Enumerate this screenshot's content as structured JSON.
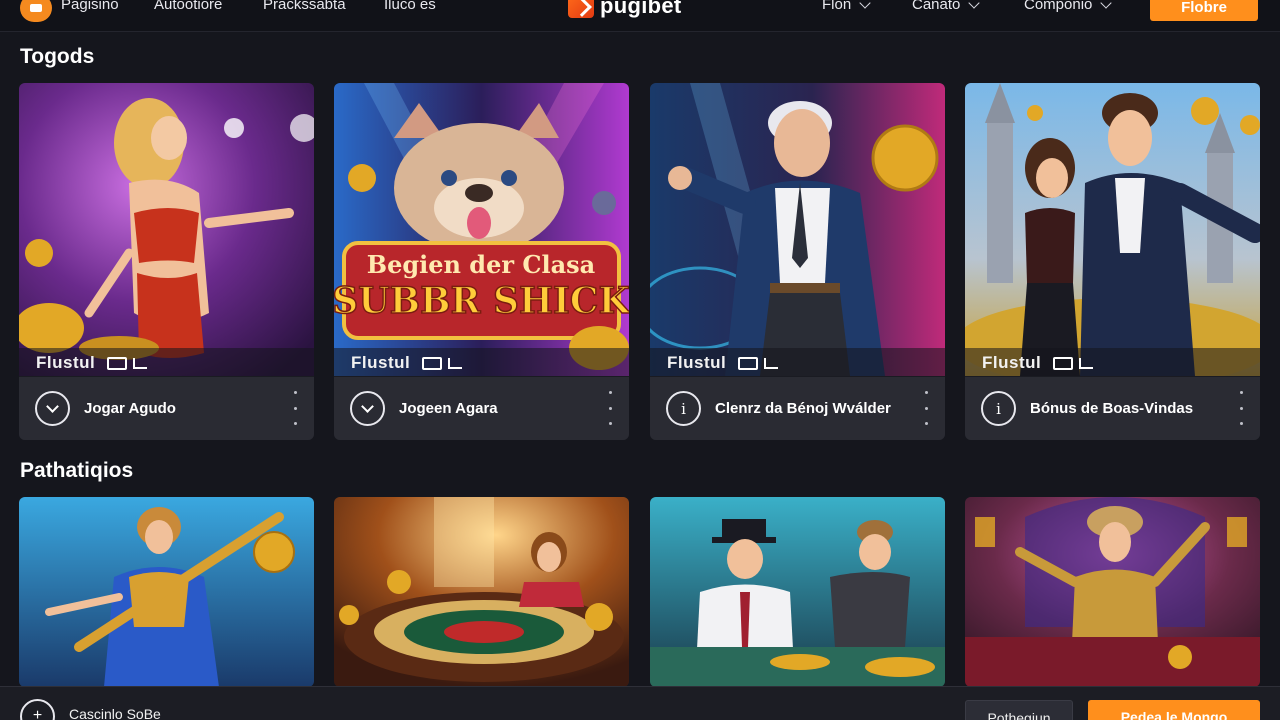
{
  "header": {
    "nav": [
      "Pagisino",
      "Autootiore",
      "Prackssabta",
      "Iluco es"
    ],
    "brand": "pugibet",
    "dropdowns": [
      "Flon",
      "Canato",
      "Componio"
    ],
    "cta": "Flobre",
    "accent": "#ff8f1c"
  },
  "section1": {
    "title": "Togods",
    "cards": [
      {
        "caption": "Flustul",
        "label": "Jogar Agudo",
        "icon": "chevron-down-icon",
        "title_art": ""
      },
      {
        "caption": "Flustul",
        "label": "Jogeen Agara",
        "icon": "chevron-down-icon",
        "title_art": "Begien der Clasa",
        "title_art2": "SUBBR SHICK"
      },
      {
        "caption": "Flustul",
        "label": "Clenrz da Bénoj Wválder",
        "icon": "info-icon",
        "title_art": ""
      },
      {
        "caption": "Flustul",
        "label": "Bónus de Boas-Vindas",
        "icon": "info-icon",
        "title_art": ""
      }
    ]
  },
  "section2": {
    "title": "Pathatiqios"
  },
  "bottom": {
    "label": "Cascinlo SoBe",
    "secondary": "Pothegiun",
    "primary": "Pedea le Mongo"
  },
  "icons": {
    "info_glyph": "i",
    "plus_glyph": "+"
  }
}
